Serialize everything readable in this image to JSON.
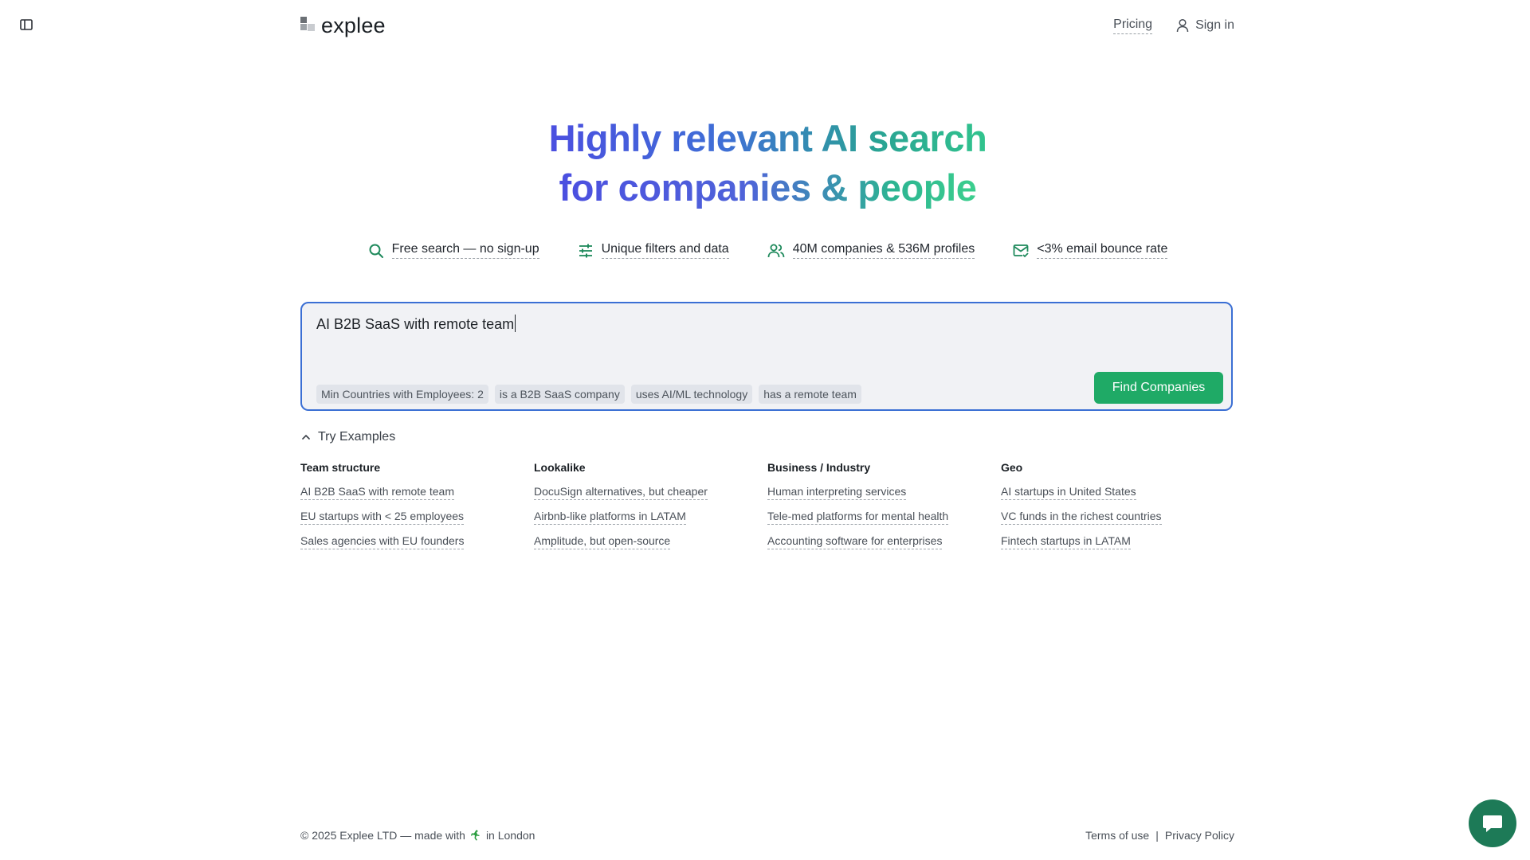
{
  "header": {
    "logo_text": "explee",
    "nav": {
      "pricing": "Pricing",
      "sign_in": "Sign in"
    }
  },
  "hero": {
    "line1_a": "Highly relevant AI search",
    "line2_a": "for companies & people"
  },
  "features": [
    {
      "icon": "search-icon",
      "label": "Free search — no sign-up"
    },
    {
      "icon": "sliders-icon",
      "label": "Unique filters and data"
    },
    {
      "icon": "users-icon",
      "label": "40M companies & 536M profiles"
    },
    {
      "icon": "mail-check-icon",
      "label": "<3% email bounce rate"
    }
  ],
  "search": {
    "value": "AI B2B SaaS with remote team",
    "chips": [
      "Min Countries with Employees: 2",
      "is a B2B SaaS company",
      "uses AI/ML technology",
      "has a remote team"
    ],
    "button_label": "Find Companies"
  },
  "examples": {
    "toggle_label": "Try Examples",
    "columns": [
      {
        "title": "Team structure",
        "items": [
          "AI B2B SaaS with remote team",
          "EU startups with < 25 employees",
          "Sales agencies with EU founders"
        ]
      },
      {
        "title": "Lookalike",
        "items": [
          "DocuSign alternatives, but cheaper",
          "Airbnb-like platforms in LATAM",
          "Amplitude, but open-source"
        ]
      },
      {
        "title": "Business / Industry",
        "items": [
          "Human interpreting services",
          "Tele-med platforms for mental health",
          "Accounting software for enterprises"
        ]
      },
      {
        "title": "Geo",
        "items": [
          "AI startups in United States",
          "VC funds in the richest countries",
          "Fintech startups in LATAM"
        ]
      }
    ]
  },
  "footer": {
    "copyright_prefix": "© 2025 Explee LTD — made with",
    "copyright_suffix": "in London",
    "terms": "Terms of use",
    "separator": "|",
    "privacy": "Privacy Policy"
  },
  "colors": {
    "accent_green": "#1faa66",
    "search_border": "#3b6fd4",
    "chat_button": "#1d7a57"
  }
}
